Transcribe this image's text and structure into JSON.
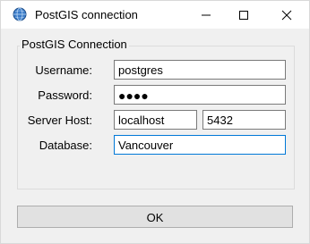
{
  "window": {
    "title": "PostGIS connection",
    "icon": "globe-icon",
    "buttons": {
      "minimize": "minimize-icon",
      "maximize": "maximize-icon",
      "close": "close-icon"
    }
  },
  "group": {
    "title": "PostGIS Connection"
  },
  "form": {
    "username": {
      "label": "Username:",
      "value": "postgres"
    },
    "password": {
      "label": "Password:",
      "mask": "●●●●"
    },
    "server": {
      "label": "Server Host:",
      "host": "localhost",
      "port": "5432"
    },
    "database": {
      "label": "Database:",
      "value": "Vancouver"
    }
  },
  "actions": {
    "ok_label": "OK"
  },
  "colors": {
    "focus_border": "#0078d7",
    "button_bg": "#e1e1e1",
    "window_bg": "#f0f0f0"
  }
}
